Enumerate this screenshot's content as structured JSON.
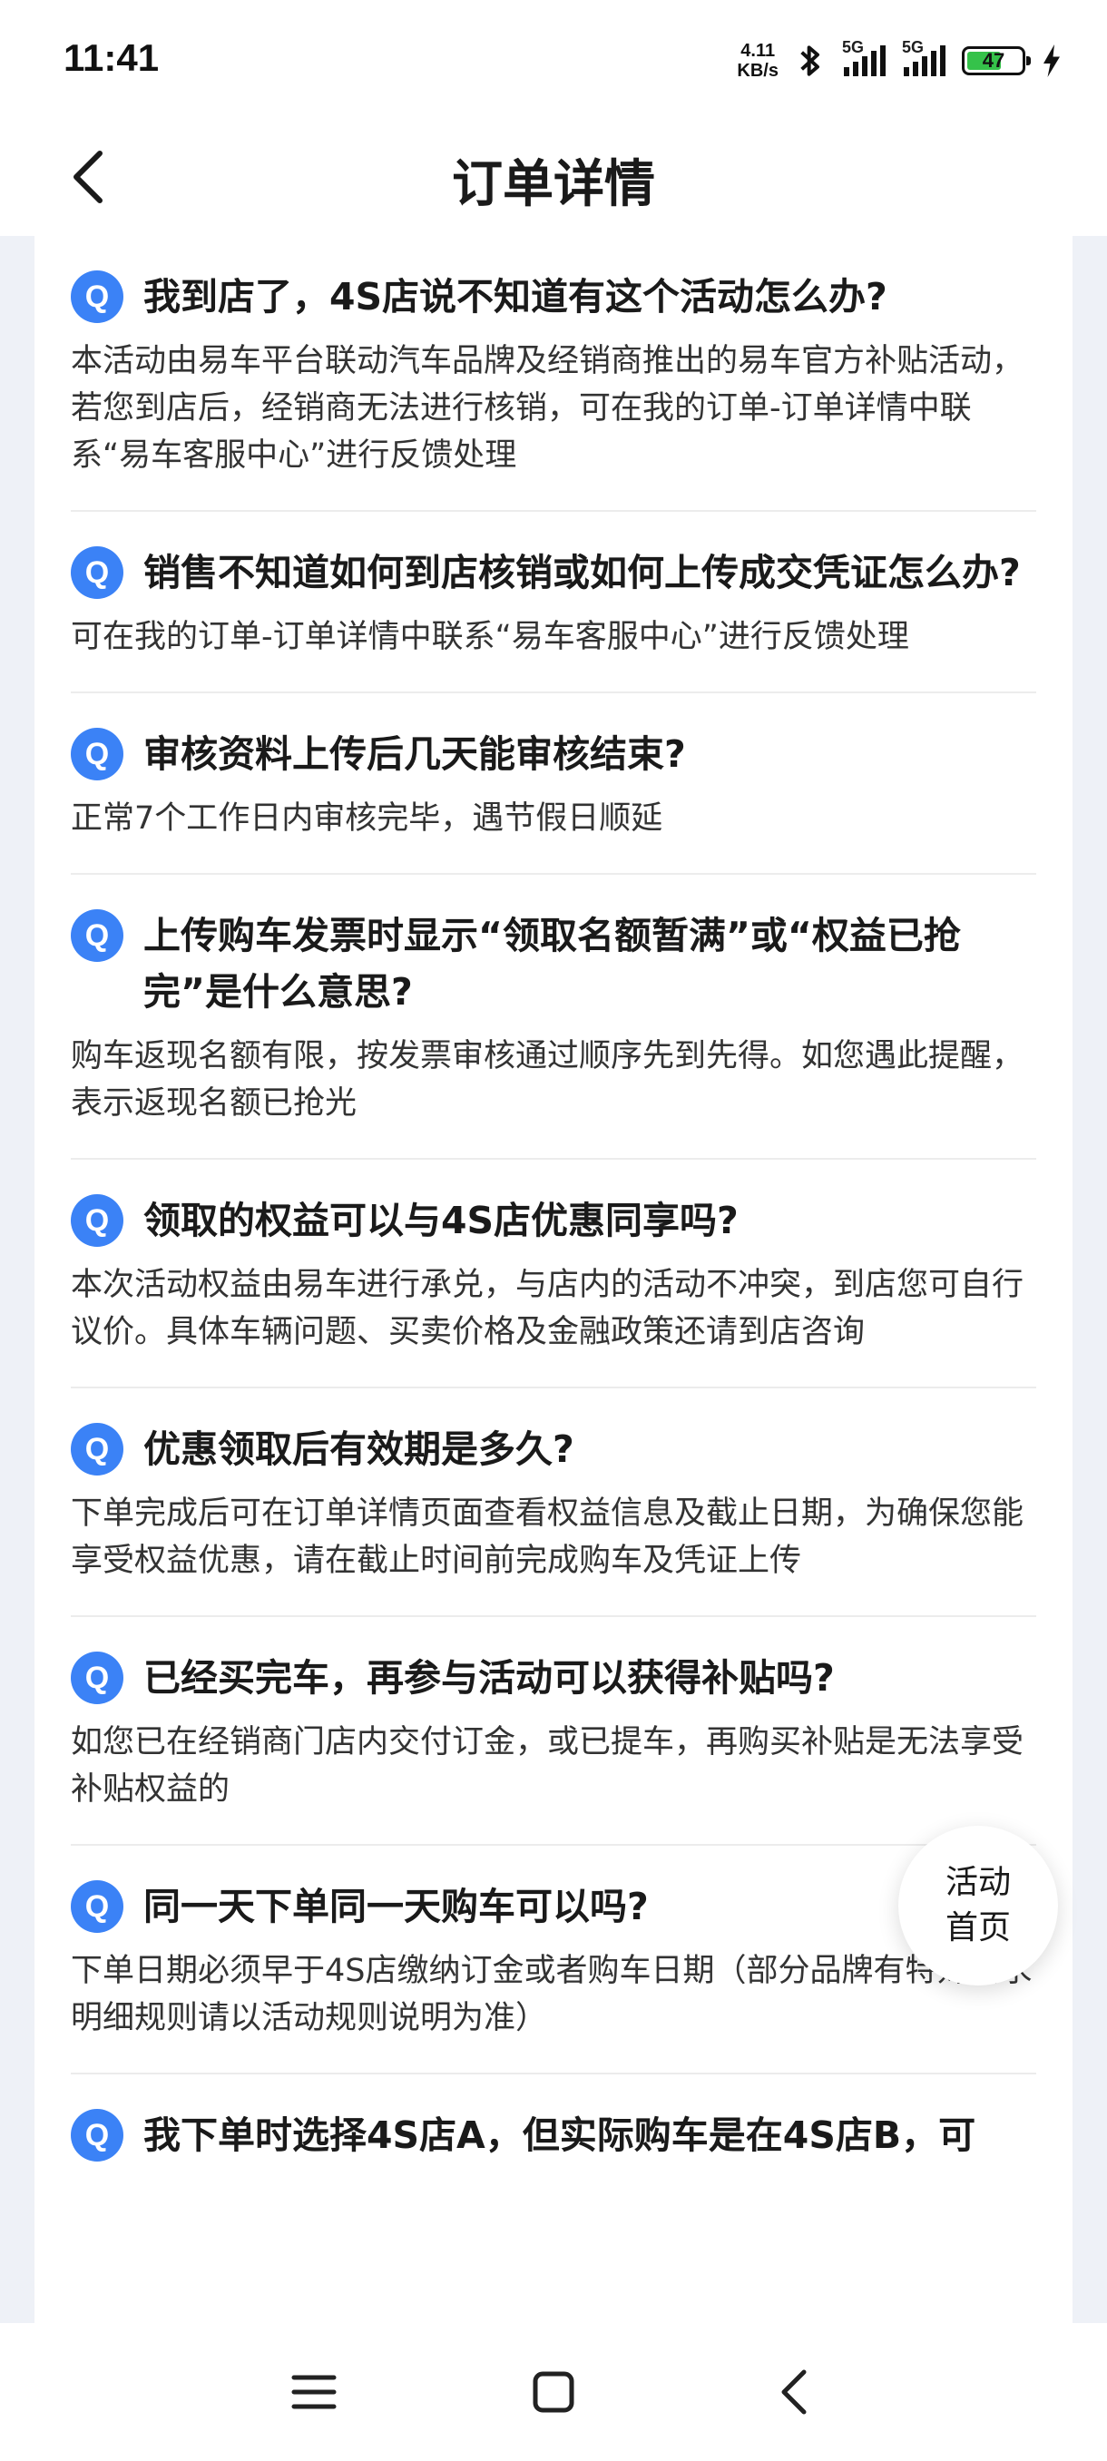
{
  "status": {
    "time": "11:41",
    "net_speed_value": "4.11",
    "net_speed_unit": "KB/s",
    "signal_label": "5G",
    "battery_level": "47"
  },
  "nav": {
    "title": "订单详情"
  },
  "faq": {
    "badge": "Q",
    "items": [
      {
        "q": "我到店了，4S店说不知道有这个活动怎么办?",
        "a": "本活动由易车平台联动汽车品牌及经销商推出的易车官方补贴活动，若您到店后，经销商无法进行核销，可在我的订单-订单详情中联系“易车客服中心”进行反馈处理"
      },
      {
        "q": "销售不知道如何到店核销或如何上传成交凭证怎么办?",
        "a": "可在我的订单-订单详情中联系“易车客服中心”进行反馈处理"
      },
      {
        "q": "审核资料上传后几天能审核结束?",
        "a": "正常7个工作日内审核完毕，遇节假日顺延"
      },
      {
        "q": "上传购车发票时显示“领取名额暂满”或“权益已抢完”是什么意思?",
        "a": "购车返现名额有限，按发票审核通过顺序先到先得。如您遇此提醒，表示返现名额已抢光"
      },
      {
        "q": "领取的权益可以与4S店优惠同享吗?",
        "a": "本次活动权益由易车进行承兑，与店内的活动不冲突，到店您可自行议价。具体车辆问题、买卖价格及金融政策还请到店咨询"
      },
      {
        "q": "优惠领取后有效期是多久?",
        "a": "下单完成后可在订单详情页面查看权益信息及截止日期，为确保您能享受权益优惠，请在截止时间前完成购车及凭证上传"
      },
      {
        "q": "已经买完车，再参与活动可以获得补贴吗?",
        "a": "如您已在经销商门店内交付订金，或已提车，再购买补贴是无法享受补贴权益的"
      },
      {
        "q": "同一天下单同一天购车可以吗?",
        "a": "下单日期必须早于4S店缴纳订金或者购车日期（部分品牌有特殊要求明细规则请以活动规则说明为准）"
      },
      {
        "q": "我下单时选择4S店A，但实际购车是在4S店B，可",
        "a": ""
      }
    ]
  },
  "float_button": {
    "line1": "活动",
    "line2": "首页"
  }
}
